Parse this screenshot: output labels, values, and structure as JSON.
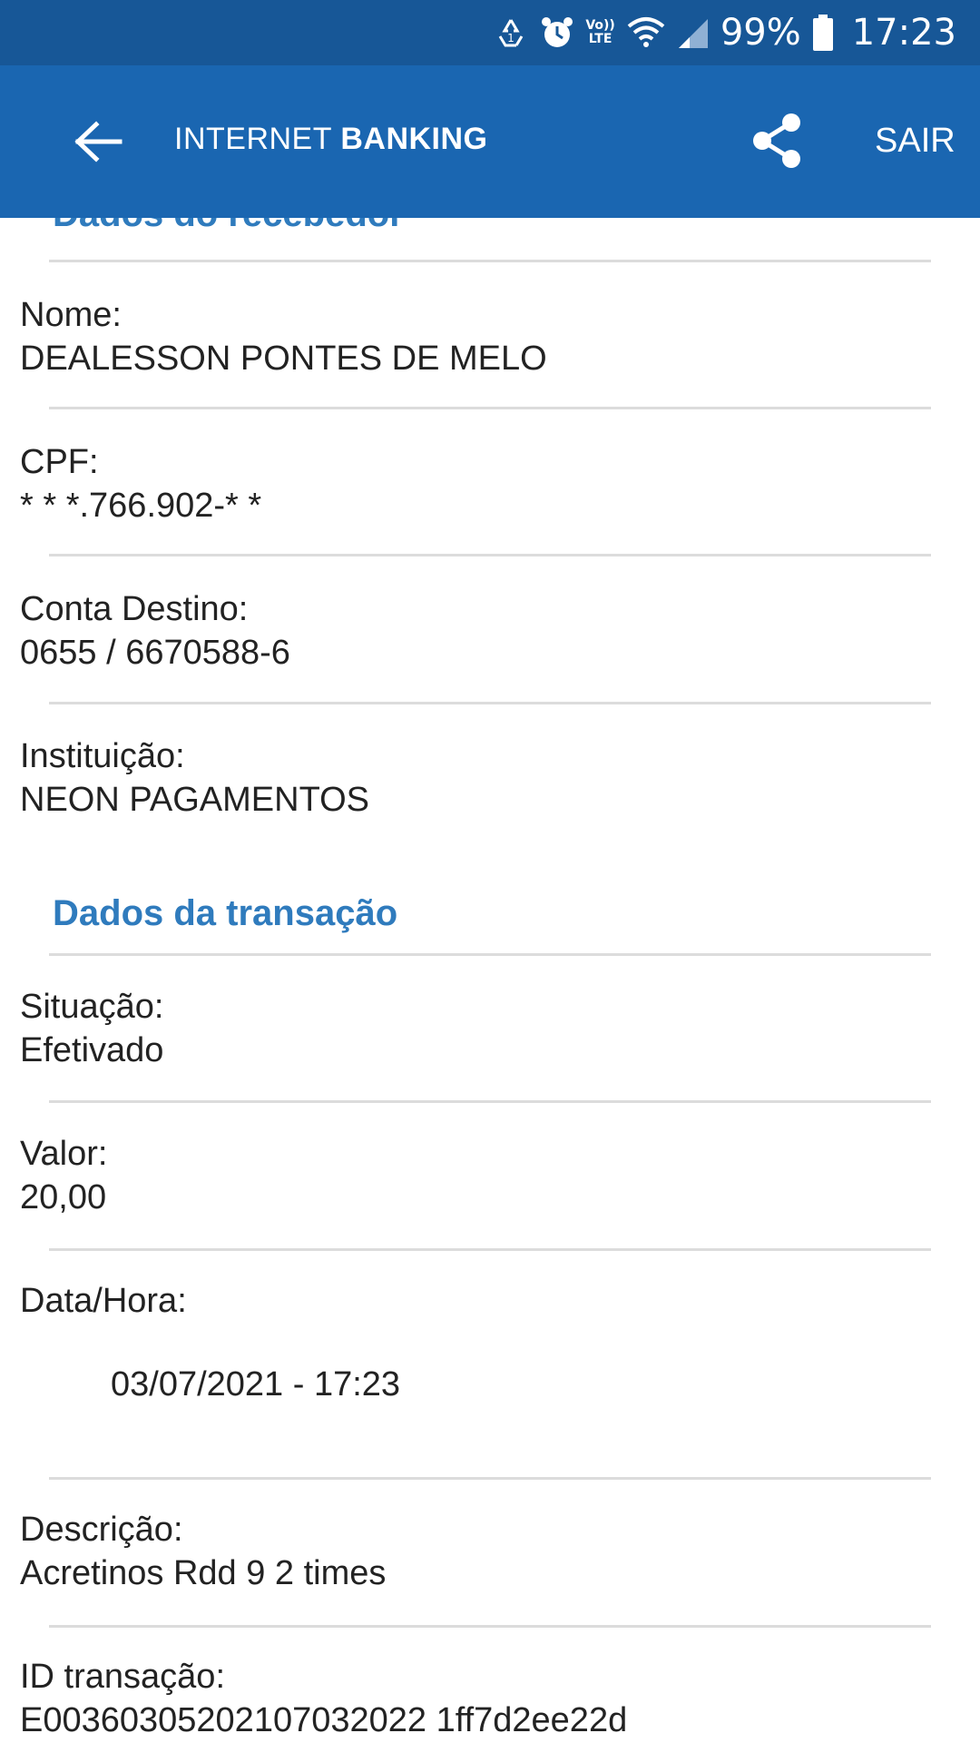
{
  "status_bar": {
    "battery_text": "99%",
    "time": "17:23",
    "lte_line1": "Vo))",
    "lte_line2": "LTE",
    "icons": [
      "recycle-icon",
      "alarm-icon",
      "volte-icon",
      "wifi-icon",
      "signal-icon",
      "battery-icon"
    ]
  },
  "app_bar": {
    "title_light": "INTERNET",
    "title_bold": "BANKING",
    "logout_label": "SAIR",
    "background_color": "#1a66b1"
  },
  "recipient": {
    "heading": "Dados do recebedor",
    "name_label": "Nome:",
    "name_value": "DEALESSON PONTES DE MELO",
    "cpf_label": "CPF:",
    "cpf_value": "* * *.766.902-* *",
    "account_label": "Conta Destino:",
    "account_value": "0655 / 6670588-6",
    "institution_label": "Instituição:",
    "institution_value": "NEON PAGAMENTOS"
  },
  "transaction": {
    "heading": "Dados da transação",
    "status_label": "Situação:",
    "status_value": "Efetivado",
    "amount_label": "Valor:",
    "amount_value": "20,00",
    "datetime_label": "Data/Hora:",
    "datetime_value": "03/07/2021 - 17:23",
    "description_label": "Descrição:",
    "description_value": "Acretinos Rdd 9 2 times",
    "id_label": "ID transação:",
    "id_value": "E00360305202107032022 1ff7d2ee22d"
  },
  "colors": {
    "status_bar": "#175797",
    "heading": "#2f7bbd",
    "divider": "#dcdcdc"
  }
}
